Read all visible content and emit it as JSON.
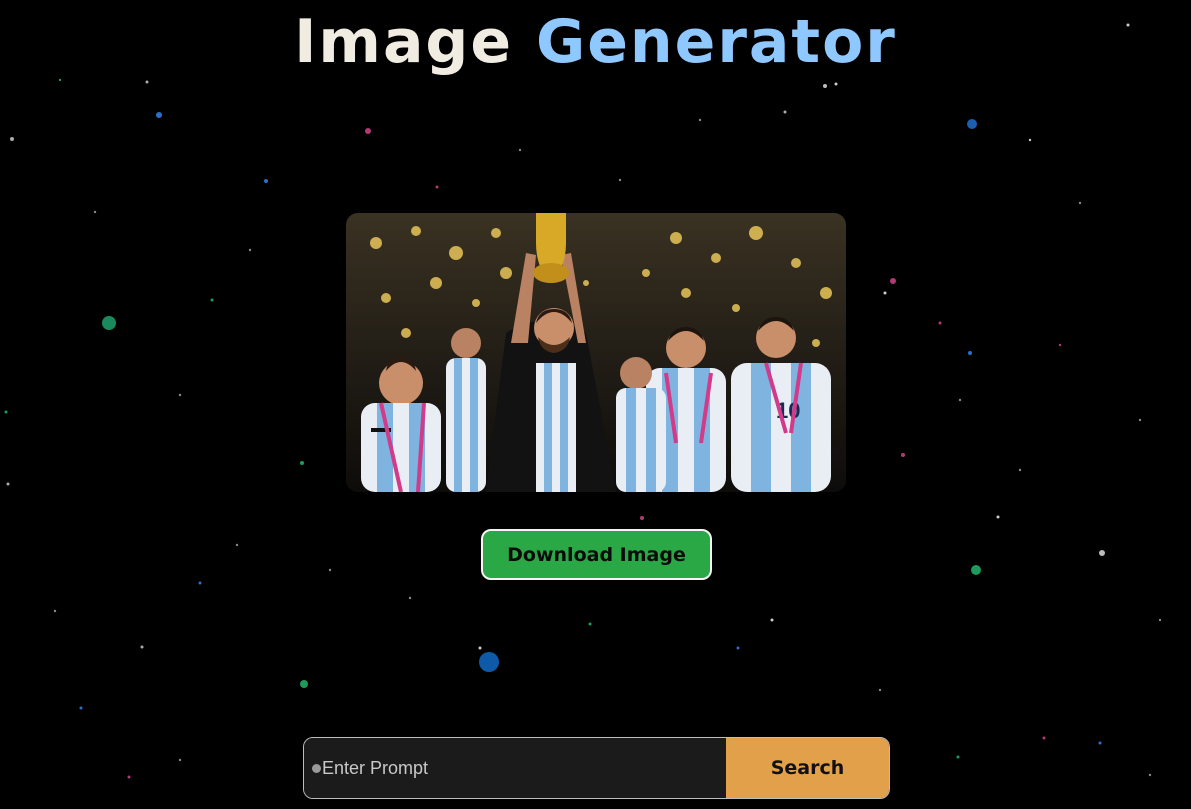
{
  "header": {
    "title_part1": "Image",
    "title_part2": "Generator"
  },
  "image": {
    "alt": "Generated image"
  },
  "actions": {
    "download_label": "Download Image"
  },
  "search": {
    "placeholder": "Enter Prompt",
    "value": "",
    "button_label": "Search"
  },
  "colors": {
    "background": "#000000",
    "title_primary": "#f1ece2",
    "title_accent": "#8fc8ff",
    "download_button": "#2aa845",
    "search_button": "#e3a04a",
    "input_background": "#1b1b1b"
  }
}
